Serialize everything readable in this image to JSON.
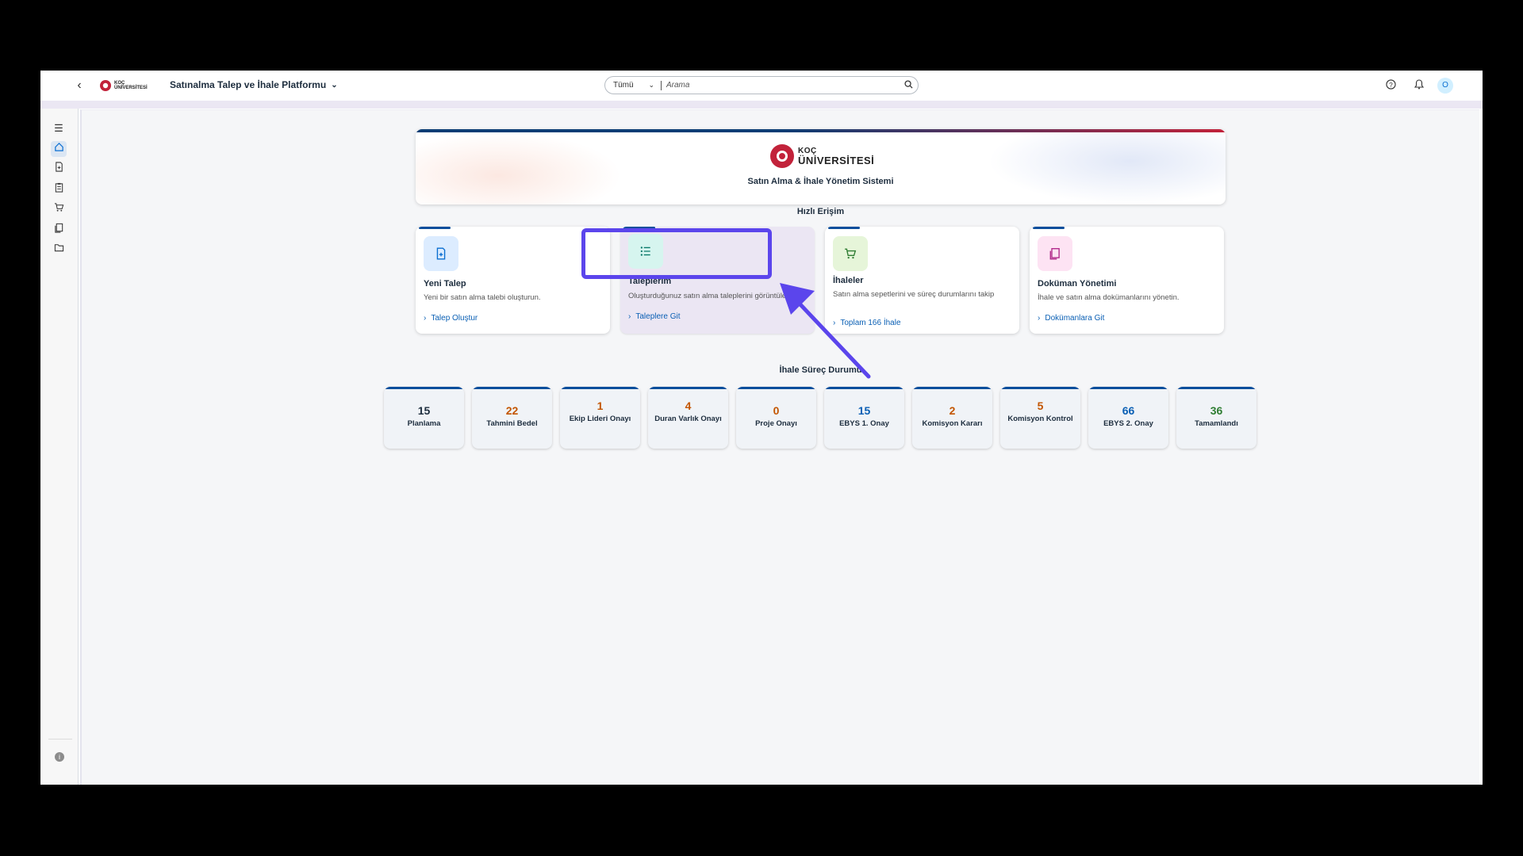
{
  "shell": {
    "logo_line1": "KOÇ",
    "logo_line2": "ÜNİVERSİTESİ",
    "app_title": "Satınalma Talep ve İhale Platformu",
    "search_scope": "Tümü",
    "search_placeholder": "Arama",
    "avatar_initial": "O"
  },
  "hero": {
    "logo_line1": "KOÇ",
    "logo_line2": "ÜNİVERSİTESİ",
    "subtitle": "Satın Alma & İhale Yönetim Sistemi"
  },
  "quick_access": {
    "title": "Hızlı Erişim",
    "cards": [
      {
        "title": "Yeni Talep",
        "description": "Yeni bir satın alma talebi oluşturun.",
        "link": "Talep Oluştur",
        "icon": "document-add-icon",
        "icon_bg": "#dcecff",
        "icon_color": "#0a6ed1"
      },
      {
        "title": "Taleplerim",
        "description": "Oluşturduğunuz satın alma taleplerini görüntüleyin.",
        "link": "Taleplere Git",
        "icon": "list-icon",
        "icon_bg": "#d6f5ef",
        "icon_color": "#0a7a6b"
      },
      {
        "title": "İhaleler",
        "description": "Satın alma sepetlerini ve süreç durumlarını takip",
        "link": "Toplam 166 İhale",
        "icon": "cart-icon",
        "icon_bg": "#e6f5d9",
        "icon_color": "#2e7d32"
      },
      {
        "title": "Doküman Yönetimi",
        "description": "İhale ve satın alma dokümanlarını yönetin.",
        "link": "Dokümanlara Git",
        "icon": "documents-icon",
        "icon_bg": "#fde3f3",
        "icon_color": "#b0288a"
      }
    ]
  },
  "process_status": {
    "title": "İhale Süreç Durumu",
    "tiles": [
      {
        "value": "15",
        "label": "Planlama",
        "color": "#1d2d3e"
      },
      {
        "value": "22",
        "label": "Tahmini Bedel",
        "color": "#c35500"
      },
      {
        "value": "1",
        "label": "Ekip Lideri Onayı",
        "color": "#c35500"
      },
      {
        "value": "4",
        "label": "Duran Varlık Onayı",
        "color": "#c35500"
      },
      {
        "value": "0",
        "label": "Proje Onayı",
        "color": "#c35500"
      },
      {
        "value": "15",
        "label": "EBYS 1. Onay",
        "color": "#0a5fb4"
      },
      {
        "value": "2",
        "label": "Komisyon Kararı",
        "color": "#c35500"
      },
      {
        "value": "5",
        "label": "Komisyon Kontrol",
        "color": "#c35500"
      },
      {
        "value": "66",
        "label": "EBYS 2. Onay",
        "color": "#0a5fb4"
      },
      {
        "value": "36",
        "label": "Tamamlandı",
        "color": "#2e7d32"
      }
    ]
  },
  "sidebar": {
    "items": [
      {
        "icon": "menu-icon"
      },
      {
        "icon": "home-icon"
      },
      {
        "icon": "document-add-icon"
      },
      {
        "icon": "clipboard-icon"
      },
      {
        "icon": "cart-icon"
      },
      {
        "icon": "documents-icon"
      },
      {
        "icon": "folder-icon"
      }
    ]
  },
  "colors": {
    "accent": "#0a4e9c",
    "highlight": "#5b45ec"
  }
}
